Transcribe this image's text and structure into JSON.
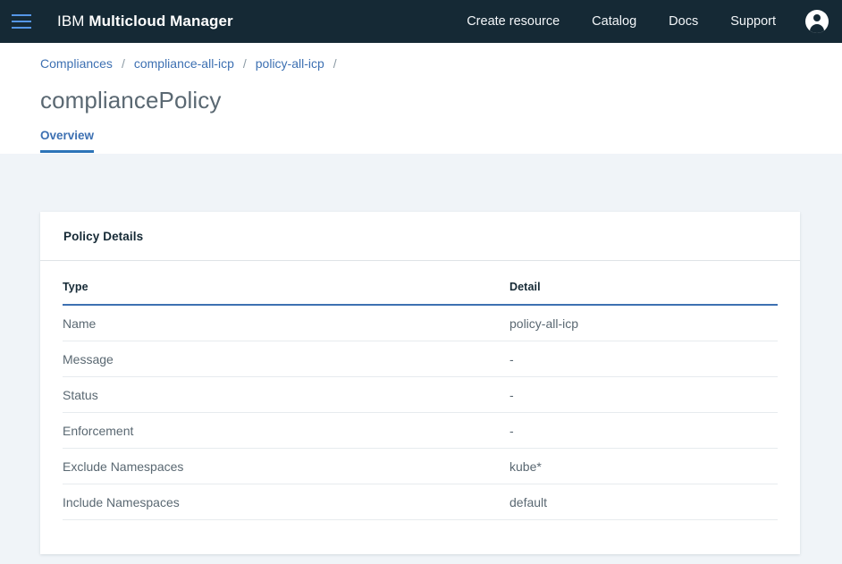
{
  "header": {
    "menu_icon": "hamburger-menu-icon",
    "brand_prefix": "IBM",
    "brand_name": "Multicloud Manager",
    "nav": [
      {
        "label": "Create resource"
      },
      {
        "label": "Catalog"
      },
      {
        "label": "Docs"
      },
      {
        "label": "Support"
      }
    ],
    "avatar_icon": "user-avatar-icon"
  },
  "breadcrumb": {
    "items": [
      {
        "label": "Compliances"
      },
      {
        "label": "compliance-all-icp"
      },
      {
        "label": "policy-all-icp"
      }
    ],
    "separator": "/"
  },
  "page": {
    "title": "compliancePolicy",
    "tabs": [
      {
        "label": "Overview",
        "active": true
      }
    ]
  },
  "card": {
    "title": "Policy Details",
    "table": {
      "columns": [
        "Type",
        "Detail"
      ],
      "rows": [
        {
          "type": "Name",
          "detail": "policy-all-icp"
        },
        {
          "type": "Message",
          "detail": "-"
        },
        {
          "type": "Status",
          "detail": "-"
        },
        {
          "type": "Enforcement",
          "detail": "-"
        },
        {
          "type": "Exclude Namespaces",
          "detail": "kube*"
        },
        {
          "type": "Include Namespaces",
          "detail": "default"
        }
      ]
    }
  },
  "colors": {
    "header_bg": "#152935",
    "page_bg": "#f0f4f8",
    "accent_blue": "#3d70b2",
    "menu_icon_blue": "#5596e6",
    "title_gray": "#5a6872",
    "card_bg": "#ffffff"
  }
}
